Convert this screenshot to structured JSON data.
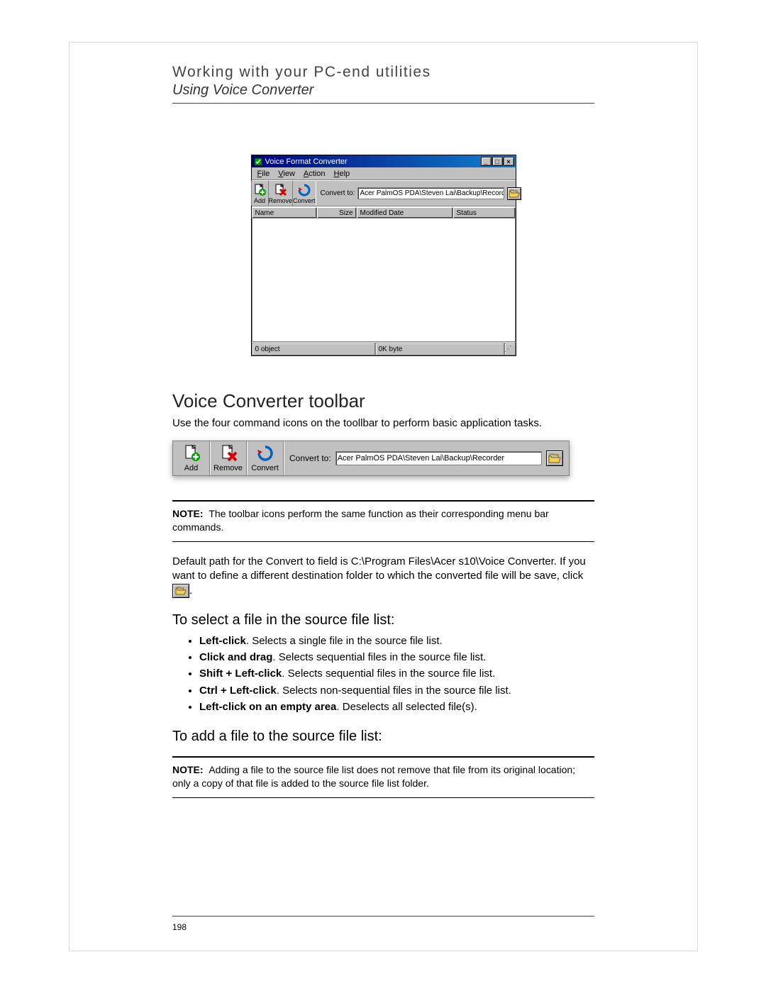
{
  "header": {
    "line1": "Working with your PC-end utilities",
    "line2": "Using Voice Converter"
  },
  "screenshot1": {
    "title": "Voice Format Converter",
    "menu": {
      "file": "File",
      "view": "View",
      "action": "Action",
      "help": "Help"
    },
    "toolbar": {
      "add": "Add",
      "remove": "Remove",
      "convert": "Convert",
      "convert_to_label": "Convert to:",
      "convert_to_path": "Acer PalmOS PDA\\Steven Lai\\Backup\\Recorder"
    },
    "columns": {
      "name": "Name",
      "size": "Size",
      "modified": "Modified Date",
      "status": "Status"
    },
    "status": {
      "left": "0 object",
      "right": "0K byte"
    }
  },
  "section": {
    "h2": "Voice Converter toolbar",
    "intro": "Use the four command icons on the toollbar to perform basic application tasks."
  },
  "screenshot2": {
    "add": "Add",
    "remove": "Remove",
    "convert": "Convert",
    "convert_to_label": "Convert to:",
    "convert_to_path": "Acer PalmOS PDA\\Steven Lai\\Backup\\Recorder"
  },
  "note1": {
    "label": "NOTE:",
    "text": "The toolbar icons perform the same function as their corresponding menu bar commands."
  },
  "para_default_path": {
    "pre": "Default path for the Convert to field is C:\\Program Files\\Acer s10\\Voice Converter. If you want to define a different destination folder to which the converted file will be save, click ",
    "post": "."
  },
  "h3_select": "To select a file in the source file list:",
  "bullets_select": [
    {
      "b": "Left-click",
      "t": ". Selects a single file in the source file list."
    },
    {
      "b": "Click and drag",
      "t": ". Selects sequential files in the source file list."
    },
    {
      "b": "Shift + Left-click",
      "t": ". Selects sequential files in the source file list."
    },
    {
      "b": "Ctrl + Left-click",
      "t": ". Selects non-sequential files in the source file list."
    },
    {
      "b": "Left-click on an empty area",
      "t": ". Deselects all selected file(s)."
    }
  ],
  "h3_add": "To add a file to the source file list:",
  "note2": {
    "label": "NOTE:",
    "text": "Adding a file to the source file list does not remove that file from its original location; only a copy of that file is added to the source file list folder."
  },
  "page_number": "198"
}
